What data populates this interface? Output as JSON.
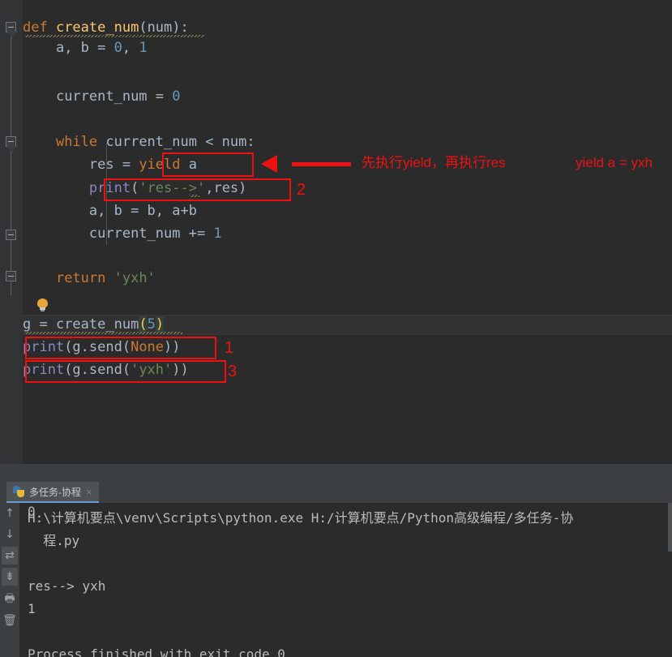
{
  "app": {
    "theme_bg": "#2b2b2b",
    "panel_bg": "#3c3f41",
    "accent": "#6b9bd2",
    "annotation_color": "#ee1111"
  },
  "editor": {
    "lines": [
      {
        "indent": 0,
        "tokens": [
          {
            "t": "def ",
            "c": "kw"
          },
          {
            "t": "create_num",
            "c": "fn"
          },
          {
            "t": "(",
            "c": "ident"
          },
          {
            "t": "num",
            "c": "param"
          },
          {
            "t": "):",
            "c": "ident"
          }
        ]
      },
      {
        "indent": 1,
        "tokens": [
          {
            "t": "a, b = ",
            "c": "ident"
          },
          {
            "t": "0",
            "c": "num"
          },
          {
            "t": ", ",
            "c": "ident"
          },
          {
            "t": "1",
            "c": "num"
          }
        ]
      },
      {
        "indent": 0,
        "tokens": []
      },
      {
        "indent": 1,
        "tokens": [
          {
            "t": "current_num = ",
            "c": "ident"
          },
          {
            "t": "0",
            "c": "num"
          }
        ]
      },
      {
        "indent": 0,
        "tokens": []
      },
      {
        "indent": 1,
        "tokens": [
          {
            "t": "while ",
            "c": "kw"
          },
          {
            "t": "current_num < num:",
            "c": "ident"
          }
        ]
      },
      {
        "indent": 2,
        "tokens": [
          {
            "t": "res = ",
            "c": "ident"
          },
          {
            "t": "yield",
            "c": "kw"
          },
          {
            "t": " a",
            "c": "ident"
          }
        ]
      },
      {
        "indent": 2,
        "tokens": [
          {
            "t": "print",
            "c": "builtin"
          },
          {
            "t": "(",
            "c": "ident"
          },
          {
            "t": "'res-->'",
            "c": "str"
          },
          {
            "t": ",res)",
            "c": "ident"
          }
        ]
      },
      {
        "indent": 2,
        "tokens": [
          {
            "t": "a, b = b, a+b",
            "c": "ident"
          }
        ]
      },
      {
        "indent": 2,
        "tokens": [
          {
            "t": "current_num += ",
            "c": "ident"
          },
          {
            "t": "1",
            "c": "num"
          }
        ]
      },
      {
        "indent": 0,
        "tokens": []
      },
      {
        "indent": 1,
        "tokens": [
          {
            "t": "return ",
            "c": "kw"
          },
          {
            "t": "'yxh'",
            "c": "str"
          }
        ]
      },
      {
        "indent": 0,
        "tokens": []
      },
      {
        "indent": 0,
        "tokens": [
          {
            "t": "g = ",
            "c": "ident"
          },
          {
            "t": "create_num",
            "c": "ident"
          },
          {
            "t": "(",
            "c": "brace"
          },
          {
            "t": "5",
            "c": "num"
          },
          {
            "t": ")",
            "c": "brace"
          }
        ]
      },
      {
        "indent": 0,
        "tokens": [
          {
            "t": "print",
            "c": "builtin"
          },
          {
            "t": "(g.send(",
            "c": "ident"
          },
          {
            "t": "None",
            "c": "kw"
          },
          {
            "t": "))",
            "c": "ident"
          }
        ]
      },
      {
        "indent": 0,
        "tokens": [
          {
            "t": "print",
            "c": "builtin"
          },
          {
            "t": "(g.send(",
            "c": "ident"
          },
          {
            "t": "'yxh'",
            "c": "str"
          },
          {
            "t": "))",
            "c": "ident"
          }
        ]
      }
    ],
    "line_plain": [
      "def create_num(num):",
      "    a, b = 0, 1",
      "",
      "    current_num = 0",
      "",
      "    while current_num < num:",
      "        res = yield a",
      "        print('res-->',res)",
      "        a, b = b, a+b",
      "        current_num += 1",
      "",
      "    return 'yxh'",
      "",
      "g = create_num(5)",
      "print(g.send(None))",
      "print(g.send('yxh'))"
    ],
    "intention_bulb": "lightbulb-icon"
  },
  "annotations": {
    "note_main": "先执行yield，再执行res",
    "note_side": "yield a = yxh",
    "marker_print_res": "2",
    "marker_send_none": "1",
    "marker_send_yxh": "3"
  },
  "console": {
    "tab": {
      "icon": "python-icon",
      "label": "多任务-协程",
      "close": "×"
    },
    "tools": [
      {
        "name": "up-arrow-icon",
        "glyph": "↑",
        "active": false
      },
      {
        "name": "down-arrow-icon",
        "glyph": "↓",
        "active": false
      },
      {
        "name": "soft-wrap-icon",
        "glyph": "⇄",
        "active": true
      },
      {
        "name": "scroll-to-end-icon",
        "glyph": "⇟",
        "active": true
      },
      {
        "name": "print-icon",
        "glyph": "🖶",
        "active": false
      },
      {
        "name": "clear-all-icon",
        "glyph": "🗑",
        "active": false
      }
    ],
    "output": [
      "H:\\计算机要点\\venv\\Scripts\\python.exe H:/计算机要点/Python高级编程/多任务-协",
      "  程.py",
      "0",
      "res--> yxh",
      "1",
      "",
      "Process finished with exit code 0"
    ]
  }
}
